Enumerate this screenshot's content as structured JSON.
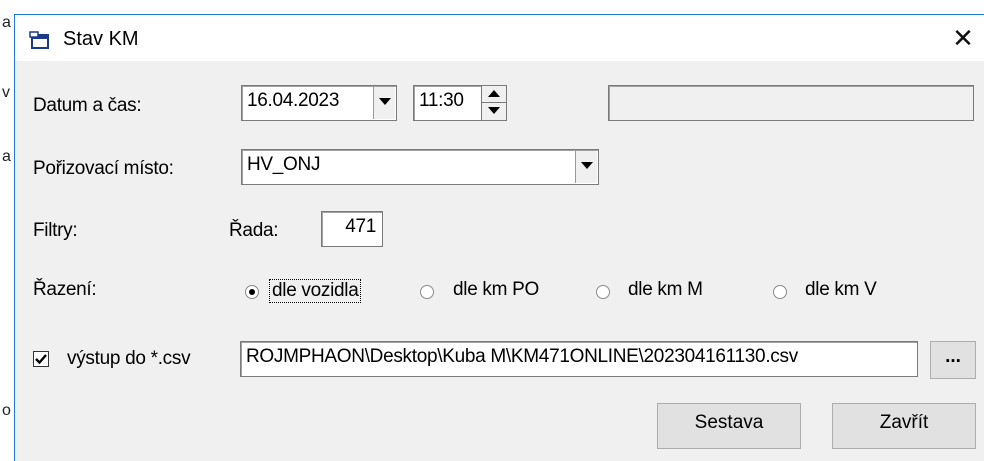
{
  "window": {
    "title": "Stav KM",
    "close_label": "✕"
  },
  "background_chars": [
    "a",
    "v",
    "a",
    "o"
  ],
  "datetime": {
    "label": "Datum a čas:",
    "date": "16.04.2023",
    "time": "11:30",
    "info": ""
  },
  "place": {
    "label": "Pořizovací místo:",
    "value": "HV_ONJ"
  },
  "filters": {
    "label": "Filtry:",
    "rada_label": "Řada:",
    "rada_value": "471"
  },
  "sort": {
    "label": "Řazení:",
    "options": [
      {
        "label": "dle vozidla",
        "checked": true
      },
      {
        "label": "dle km PO",
        "checked": false
      },
      {
        "label": "dle km M",
        "checked": false
      },
      {
        "label": "dle km V",
        "checked": false
      }
    ]
  },
  "csv": {
    "label": "výstup do *.csv",
    "checked": true,
    "path": "ROJMPHAON\\Desktop\\Kuba M\\KM471ONLINE\\202304161130.csv",
    "browse_label": "..."
  },
  "buttons": {
    "report": "Sestava",
    "close": "Zavřít"
  }
}
